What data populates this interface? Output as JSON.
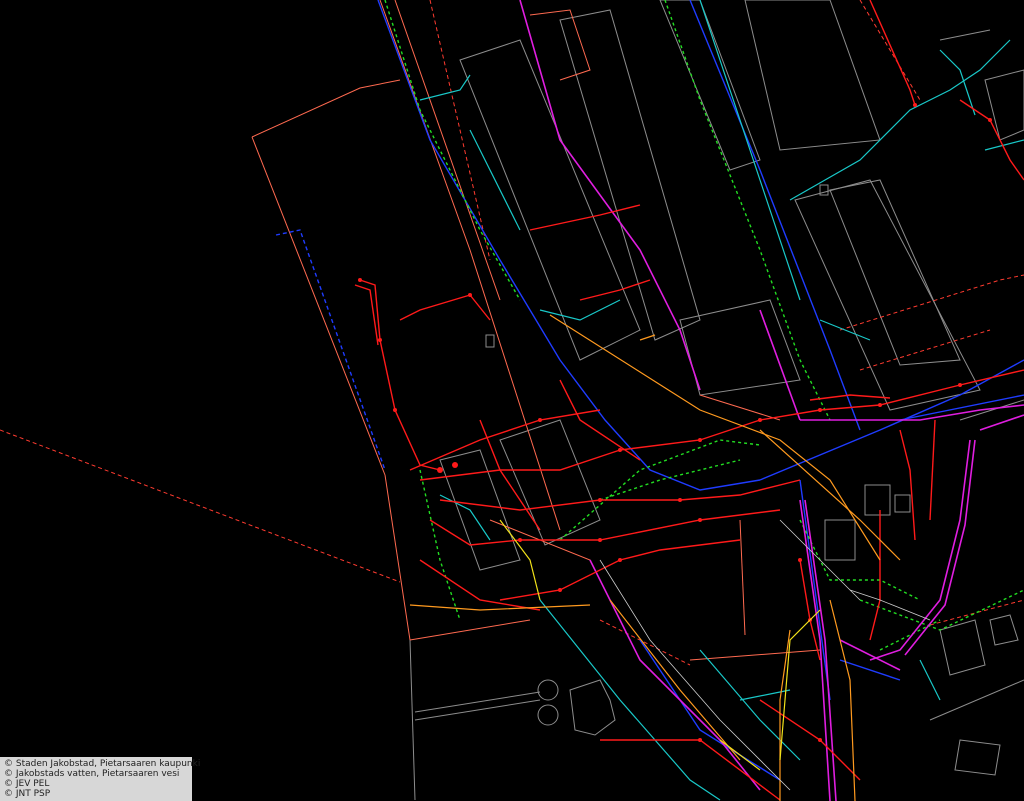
{
  "map": {
    "background": "#000000",
    "layer_colors": {
      "outline": "#9a9a9a",
      "water_main": "#ff1a1a",
      "water_dashed": "#ff3b30",
      "sewer": "#1f3cff",
      "storm": "#19c8c8",
      "pressure": "#22dd22",
      "district_heat": "#e01ee0",
      "gas": "#ff9a1f",
      "boundary": "#ff6a3a"
    }
  },
  "attribution": {
    "lines": [
      "© Staden Jakobstad, Pietarsaaren kaupunki",
      "© Jakobstads vatten, Pietarsaaren vesi",
      "© JEV PEL",
      "© JNT PSP"
    ]
  }
}
